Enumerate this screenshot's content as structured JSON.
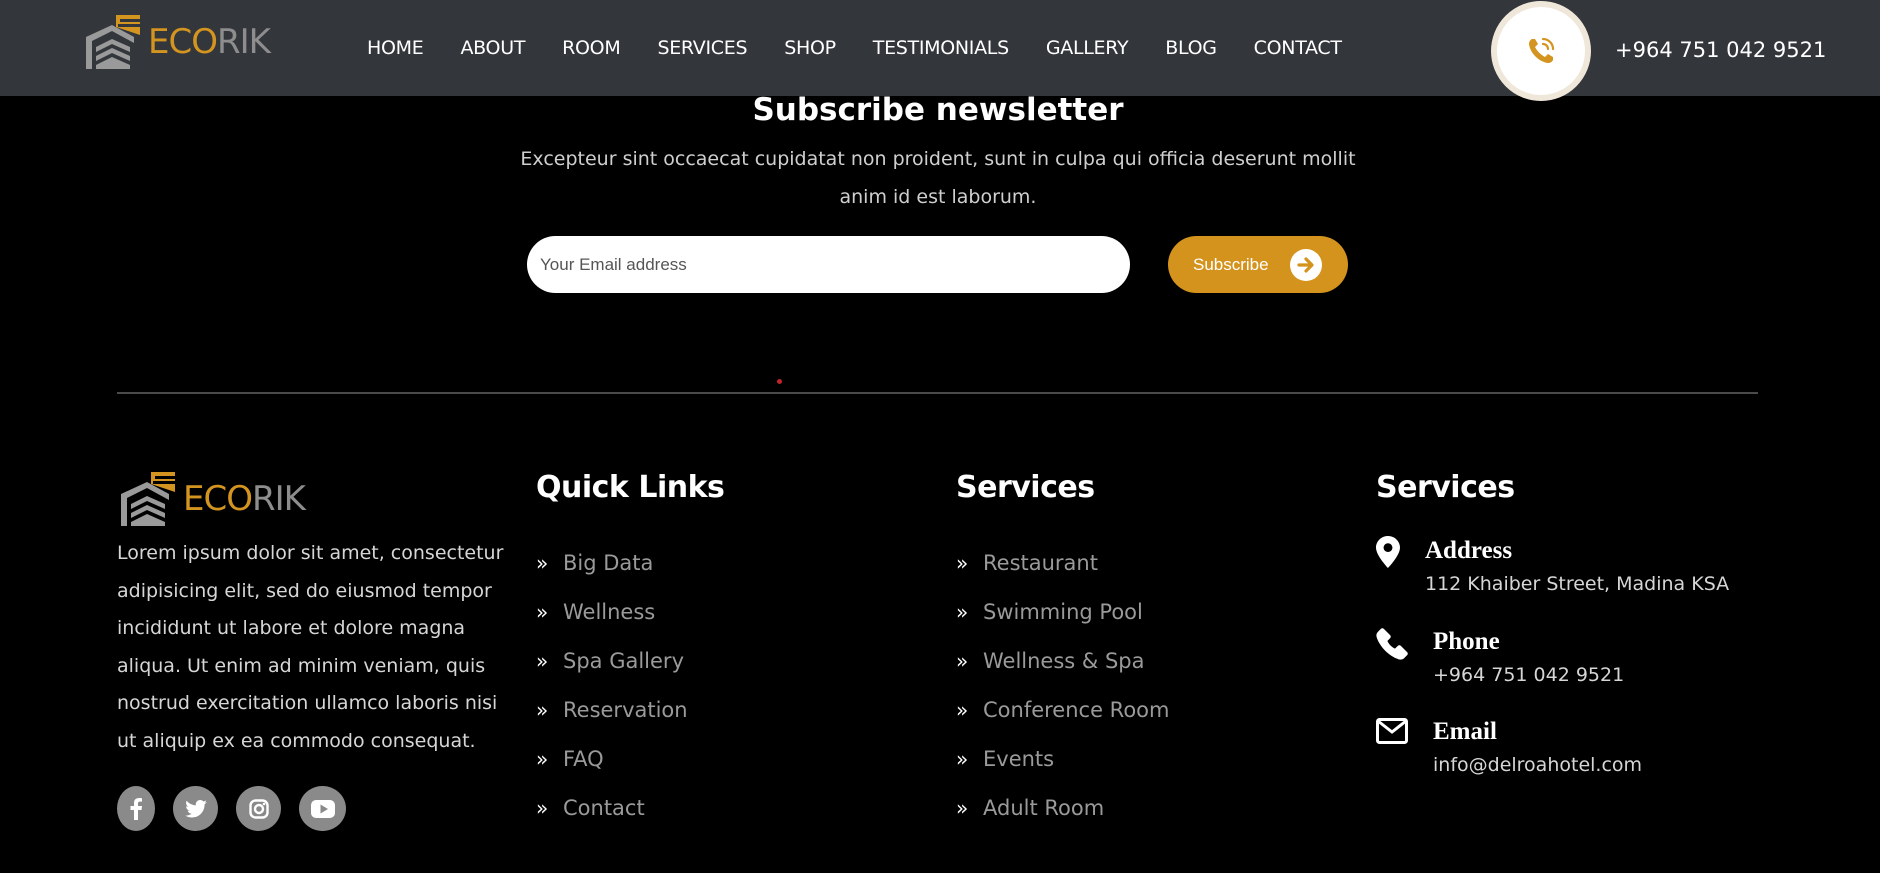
{
  "brand": {
    "name_part1": "ECO",
    "name_part2": "RIK",
    "accent": "#d49520",
    "grey": "#8d8d8d",
    "logo_icon": "house-stripes-logo"
  },
  "header": {
    "nav": [
      "HOME",
      "ABOUT",
      "ROOM",
      "SERVICES",
      "SHOP",
      "TESTIMONIALS",
      "GALLERY",
      "BLOG",
      "CONTACT"
    ],
    "phone_icon": "phone-ringing-icon",
    "phone": "+964 751 042 9521"
  },
  "newsletter": {
    "title": "Subscribe newsletter",
    "description": "Excepteur sint occaecat cupidatat non proident, sunt in culpa qui officia deserunt mollit anim id est laborum.",
    "email_placeholder": "Your Email address",
    "email_value": "",
    "button_label": "Subscribe",
    "button_icon": "arrow-right-circle-icon"
  },
  "footer": {
    "about": "Lorem ipsum dolor sit amet, consectetur adipisicing elit, sed do eiusmod tempor incididunt ut labore et dolore magna aliqua. Ut enim ad minim veniam, quis nostrud exercitation ullamco laboris nisi ut aliquip ex ea commodo consequat.",
    "socials": [
      "facebook-icon",
      "twitter-icon",
      "instagram-icon",
      "youtube-icon"
    ],
    "quick_links": {
      "title": "Quick Links",
      "items": [
        "Big Data",
        "Wellness",
        "Spa Gallery",
        "Reservation",
        "FAQ",
        "Contact"
      ]
    },
    "services": {
      "title": "Services",
      "items": [
        "Restaurant",
        "Swimming Pool",
        "Wellness & Spa",
        "Conference Room",
        "Events",
        "Adult Room"
      ]
    },
    "contact": {
      "title": "Services",
      "address_label": "Address",
      "address": "112 Khaiber Street, Madina KSA",
      "phone_label": "Phone",
      "phone": "+964 751 042 9521",
      "email_label": "Email",
      "email": "info@delroahotel.com"
    }
  }
}
